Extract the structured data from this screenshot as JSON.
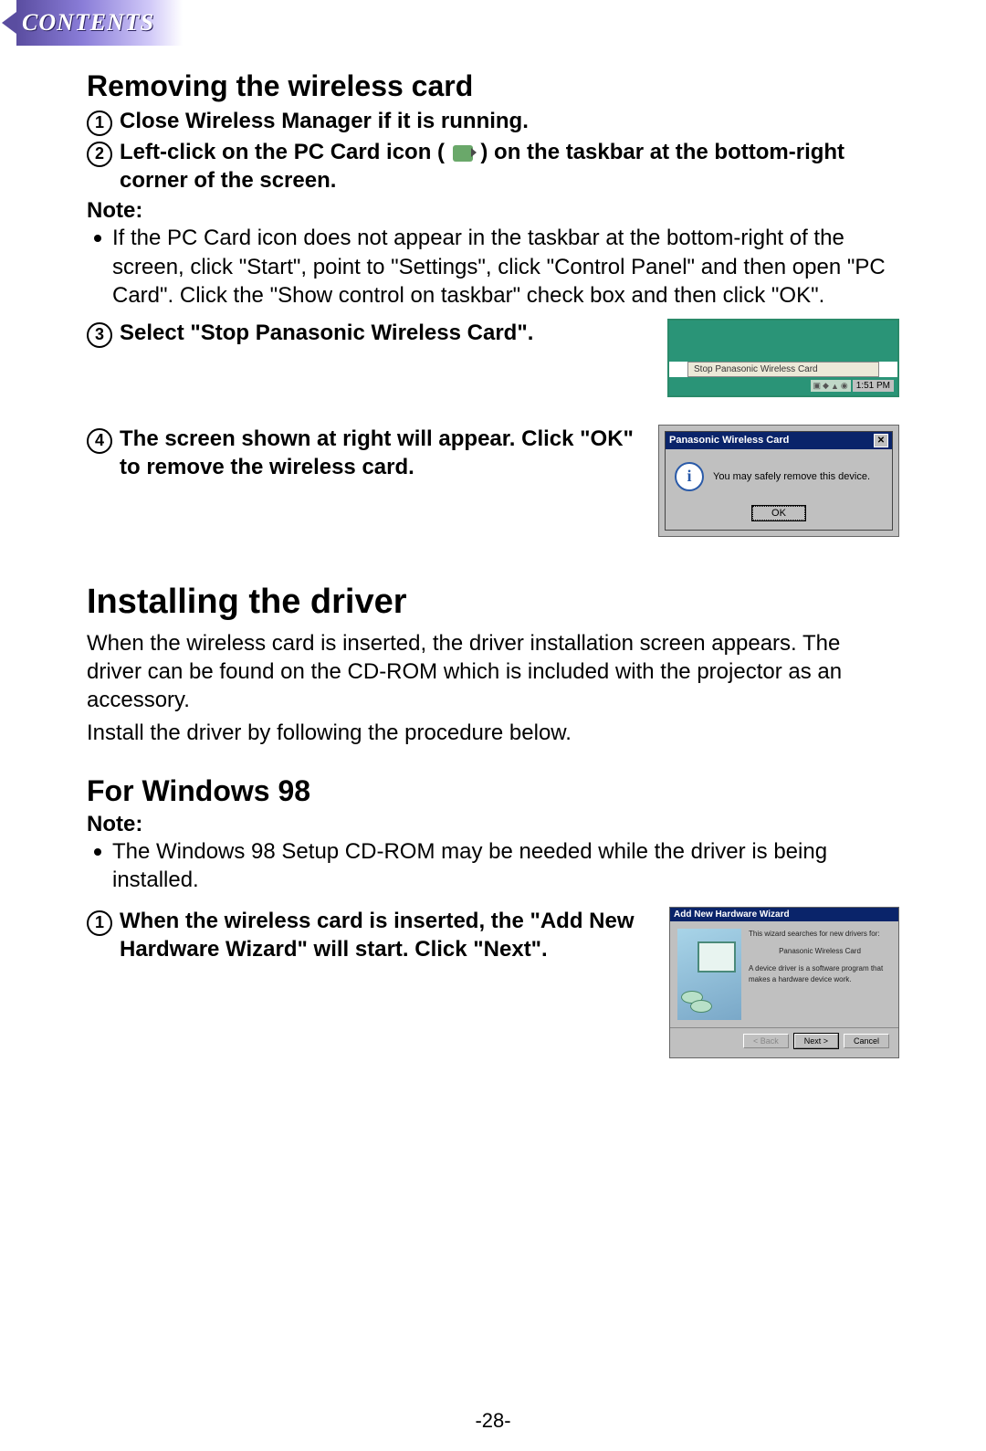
{
  "header": {
    "contents_label": "CONTENTS"
  },
  "section_remove": {
    "heading": "Removing the wireless card",
    "step1": "Close Wireless Manager if it is running.",
    "step2_a": "Left-click on the PC Card icon (",
    "step2_b": ") on the taskbar at the bottom-right corner of the screen.",
    "note_label": "Note:",
    "note_bullet": "If the PC Card icon does not appear in the taskbar at the bottom-right of the screen, click \"Start\", point to \"Settings\", click \"Control Panel\" and then open \"PC Card\". Click the \"Show control on taskbar\" check box and then click \"OK\".",
    "step3": "Select \"Stop Panasonic Wireless Card\".",
    "step4": "The screen shown at right will appear. Click \"OK\" to remove the wireless card."
  },
  "fig_taskbar": {
    "menu_item": "Stop Panasonic Wireless Card",
    "time": "1:51 PM"
  },
  "fig_dialog": {
    "title": "Panasonic Wireless Card",
    "message": "You may safely remove this device.",
    "ok": "OK"
  },
  "section_install": {
    "heading": "Installing the driver",
    "para1": "When the wireless card is inserted, the driver installation screen appears. The driver can be found on the CD-ROM which is included with the projector as an accessory.",
    "para2": "Install the driver by following the procedure below.",
    "subheading": "For Windows 98",
    "note_label": "Note:",
    "note_bullet": "The Windows 98 Setup CD-ROM may be needed while the driver is being installed.",
    "step1": "When the wireless card is inserted, the \"Add New Hardware Wizard\" will start. Click \"Next\"."
  },
  "fig_wizard": {
    "title": "Add New Hardware Wizard",
    "line1": "This wizard searches for new drivers for:",
    "device": "Panasonic Wireless Card",
    "line2": "A device driver is a software program that makes a hardware device work.",
    "btn_back": "< Back",
    "btn_next": "Next >",
    "btn_cancel": "Cancel"
  },
  "page_number": "-28-"
}
